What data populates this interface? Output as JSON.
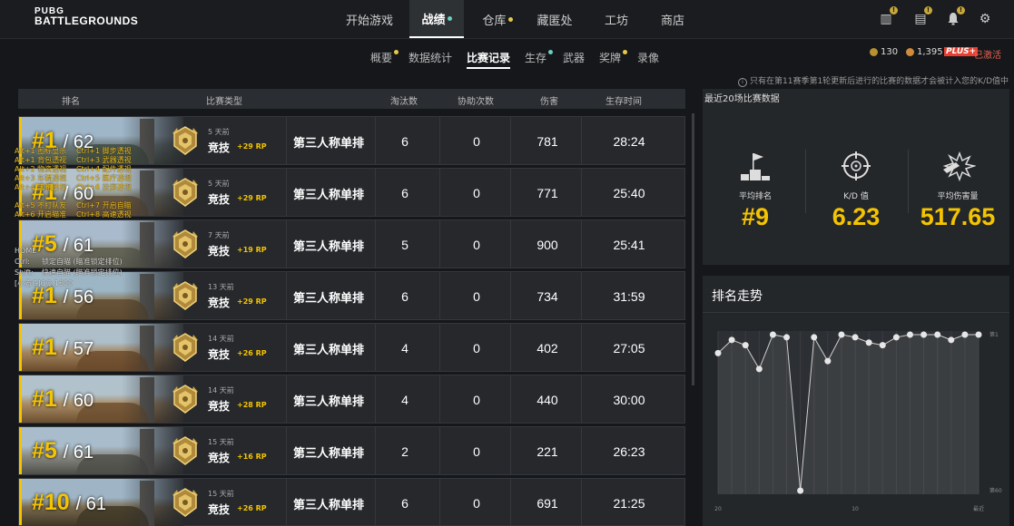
{
  "app": {
    "logo_top": "PUBG",
    "logo_bottom": "BATTLEGROUNDS",
    "nav": [
      {
        "label": "开始游戏",
        "active": false,
        "dot": false
      },
      {
        "label": "战绩",
        "active": true,
        "dot": true
      },
      {
        "label": "仓库",
        "active": false,
        "dot": true
      },
      {
        "label": "藏匿处",
        "active": false,
        "dot": false
      },
      {
        "label": "工坊",
        "active": false,
        "dot": false
      },
      {
        "label": "商店",
        "active": false,
        "dot": false
      }
    ],
    "top_icons": [
      {
        "name": "missions-icon",
        "glyph": "▥",
        "badge": "!"
      },
      {
        "name": "news-icon",
        "glyph": "▤",
        "badge": "!"
      },
      {
        "name": "bell-icon",
        "glyph": "🔔",
        "badge": "!"
      },
      {
        "name": "gear-icon",
        "glyph": "⚙",
        "badge": ""
      }
    ]
  },
  "subnav": [
    {
      "label": "概要",
      "dot": true,
      "active": false
    },
    {
      "label": "数据统计",
      "dot": false,
      "active": false
    },
    {
      "label": "比赛记录",
      "dot": false,
      "active": true
    },
    {
      "label": "生存",
      "dot": true,
      "active": false
    },
    {
      "label": "武器",
      "dot": false,
      "active": false
    },
    {
      "label": "奖牌",
      "dot": true,
      "active": false
    },
    {
      "label": "录像",
      "dot": false,
      "active": false
    }
  ],
  "currency": {
    "bp": "130",
    "gcoin": "1,395",
    "plus": "PLUS+",
    "activated": "已激活"
  },
  "notice": "只有在第11赛季第1轮更新后进行的比赛的数据才会被计入您的K/D值中",
  "table": {
    "headers": {
      "rank": "排名",
      "match_type": "比赛类型",
      "kills": "淘汰数",
      "assists": "协助次数",
      "damage": "伤害",
      "survival": "生存时间"
    },
    "rows": [
      {
        "place": "#1",
        "total": "/ 62",
        "ago": "5 天前",
        "mode": "竞技",
        "rp": "+29 RP",
        "type": "第三人称单排",
        "kills": "6",
        "assists": "0",
        "damage": "781",
        "time": "28:24"
      },
      {
        "place": "#1",
        "total": "/ 60",
        "ago": "5 天前",
        "mode": "竞技",
        "rp": "+29 RP",
        "type": "第三人称单排",
        "kills": "6",
        "assists": "0",
        "damage": "771",
        "time": "25:40"
      },
      {
        "place": "#5",
        "total": "/ 61",
        "ago": "7 天前",
        "mode": "竞技",
        "rp": "+19 RP",
        "type": "第三人称单排",
        "kills": "5",
        "assists": "0",
        "damage": "900",
        "time": "25:41"
      },
      {
        "place": "#1",
        "total": "/ 56",
        "ago": "13 天前",
        "mode": "竞技",
        "rp": "+29 RP",
        "type": "第三人称单排",
        "kills": "6",
        "assists": "0",
        "damage": "734",
        "time": "31:59"
      },
      {
        "place": "#1",
        "total": "/ 57",
        "ago": "14 天前",
        "mode": "竞技",
        "rp": "+26 RP",
        "type": "第三人称单排",
        "kills": "4",
        "assists": "0",
        "damage": "402",
        "time": "27:05"
      },
      {
        "place": "#1",
        "total": "/ 60",
        "ago": "14 天前",
        "mode": "竞技",
        "rp": "+28 RP",
        "type": "第三人称单排",
        "kills": "4",
        "assists": "0",
        "damage": "440",
        "time": "30:00"
      },
      {
        "place": "#5",
        "total": "/ 61",
        "ago": "15 天前",
        "mode": "竞技",
        "rp": "+16 RP",
        "type": "第三人称单排",
        "kills": "2",
        "assists": "0",
        "damage": "221",
        "time": "26:23"
      },
      {
        "place": "#10",
        "total": "/ 61",
        "ago": "15 天前",
        "mode": "竞技",
        "rp": "+26 RP",
        "type": "第三人称单排",
        "kills": "6",
        "assists": "0",
        "damage": "691",
        "time": "21:25"
      }
    ]
  },
  "recent": {
    "title": "最近20场比赛数据",
    "avg_rank_label": "平均排名",
    "avg_rank": "#9",
    "kd_label": "K/D 值",
    "kd": "6.23",
    "avg_damage_label": "平均伤害量",
    "avg_damage": "517.65"
  },
  "trend": {
    "title": "排名走势",
    "top_label": "第1",
    "bottom_label": "第60",
    "x_labels": [
      "20",
      "10",
      "最近"
    ]
  },
  "chart_data": {
    "type": "line",
    "title": "排名走势",
    "x": [
      20,
      19,
      18,
      17,
      16,
      15,
      14,
      13,
      12,
      11,
      10,
      9,
      8,
      7,
      6,
      5,
      4,
      3,
      2,
      1
    ],
    "values": [
      8,
      3,
      5,
      14,
      1,
      2,
      60,
      2,
      11,
      1,
      2,
      4,
      5,
      2,
      1,
      1,
      1,
      3,
      1,
      1
    ],
    "y_inverted": true,
    "ylim": [
      1,
      60
    ],
    "grid": true
  },
  "overlay_text": {
    "l1": "Alt+1 图标显示",
    "l2": "Ctrl+1 脚步透视",
    "l3": "Alt+1 背包透视",
    "l4": "Ctrl+3 武器透视",
    "l5": "Alt+2 物资透视",
    "l6": "Ctrl+4 配件透视",
    "l7": "Alt+3 车辆透视",
    "l8": "Ctrl+5 医疗透视",
    "l9": "Alt+4 宝箱透视",
    "l10": "Ctrl+6 投掷透视",
    "l11": "Alt+5 不打队友",
    "l12": "Ctrl+7 开启自瞄",
    "l13": "Alt+6 开启瞄准",
    "l14": "Ctrl+8 高速透视",
    "home": "HOME",
    "ctrl": "Ctrl:",
    "ctrl_desc": "锁定自瞄 (瞄准锁定排位)",
    "shift": "Shift:",
    "shift_desc": "快速自瞄 (瞄准锁定排位)",
    "contact": "[小方G]QQ:1600"
  }
}
